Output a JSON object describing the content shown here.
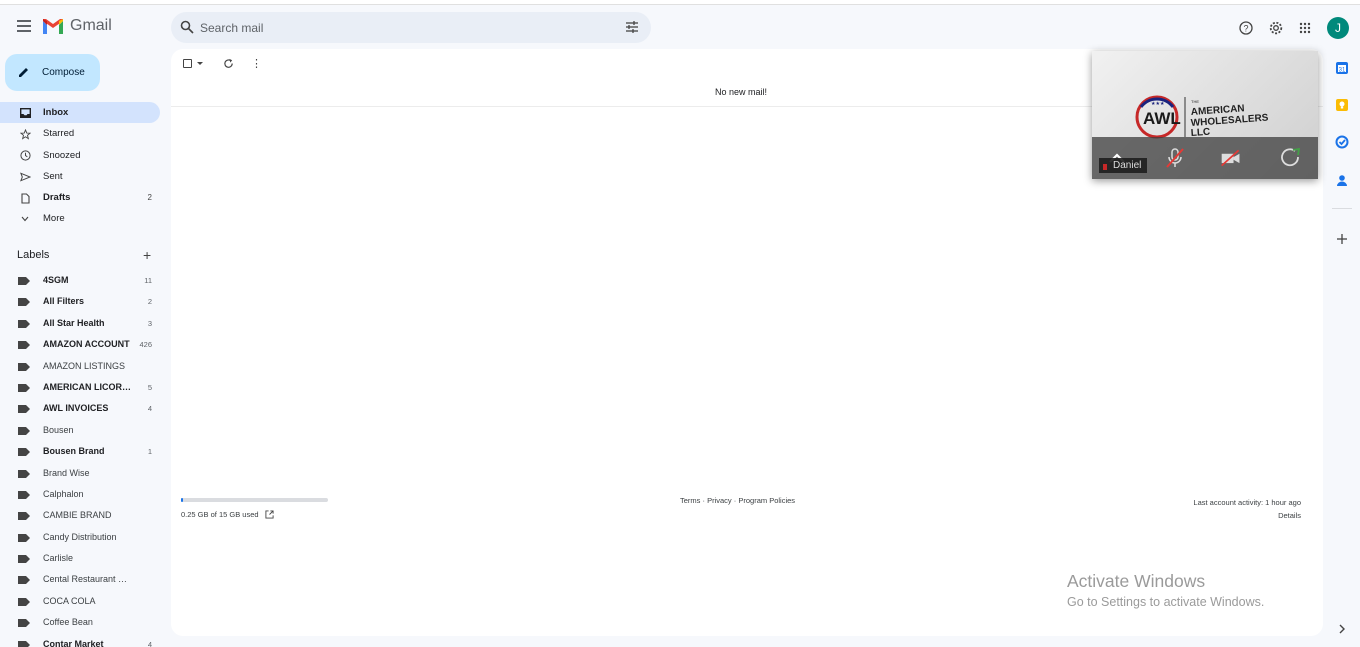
{
  "app": {
    "title": "Gmail"
  },
  "search": {
    "placeholder": "Search mail"
  },
  "header": {
    "avatar_initial": "J",
    "icons": [
      "help-icon",
      "settings-gear-icon",
      "apps-grid-icon"
    ]
  },
  "compose": {
    "label": "Compose"
  },
  "nav": {
    "items": [
      {
        "label": "Inbox",
        "count": "",
        "icon": "inbox-icon",
        "active": true
      },
      {
        "label": "Starred",
        "count": "",
        "icon": "star-icon"
      },
      {
        "label": "Snoozed",
        "count": "",
        "icon": "clock-icon"
      },
      {
        "label": "Sent",
        "count": "",
        "icon": "send-icon"
      },
      {
        "label": "Drafts",
        "count": "2",
        "icon": "draft-icon"
      },
      {
        "label": "More",
        "count": "",
        "icon": "chevron-down-icon"
      }
    ]
  },
  "labels": {
    "header": "Labels",
    "items": [
      {
        "label": "4SGM",
        "count": "11",
        "bold": true
      },
      {
        "label": "All Filters",
        "count": "2",
        "bold": true
      },
      {
        "label": "All Star Health",
        "count": "3",
        "bold": true
      },
      {
        "label": "AMAZON ACCOUNT",
        "count": "426",
        "bold": true
      },
      {
        "label": "AMAZON LISTINGS",
        "count": "",
        "bold": false
      },
      {
        "label": "AMERICAN LICORICE",
        "count": "5",
        "bold": true
      },
      {
        "label": "AWL INVOICES",
        "count": "4",
        "bold": true
      },
      {
        "label": "Bousen",
        "count": "",
        "bold": false
      },
      {
        "label": "Bousen Brand",
        "count": "1",
        "bold": true
      },
      {
        "label": "Brand Wise",
        "count": "",
        "bold": false
      },
      {
        "label": "Calphalon",
        "count": "",
        "bold": false
      },
      {
        "label": "CAMBIE BRAND",
        "count": "",
        "bold": false
      },
      {
        "label": "Candy Distribution",
        "count": "",
        "bold": false
      },
      {
        "label": "Carlisle",
        "count": "",
        "bold": false
      },
      {
        "label": "Cental Restaurant Quotes",
        "count": "",
        "bold": false
      },
      {
        "label": "COCA COLA",
        "count": "",
        "bold": false
      },
      {
        "label": "Coffee Bean",
        "count": "",
        "bold": false
      },
      {
        "label": "Contar Market",
        "count": "4",
        "bold": true
      }
    ]
  },
  "main": {
    "empty_message": "No new mail!",
    "storage_text": "0.25 GB of 15 GB used",
    "storage_fraction": 0.017,
    "footer": {
      "terms": "Terms",
      "privacy": "Privacy",
      "policies": "Program Policies",
      "sep": " · "
    },
    "activity": {
      "text": "Last account activity: 1 hour ago",
      "details": "Details"
    }
  },
  "video": {
    "participant_name": "Daniel",
    "logo_mark": "AWL",
    "logo_the": "THE",
    "logo_line1": "AMERICAN",
    "logo_line2": "WHOLESALERS",
    "logo_line3": "LLC"
  },
  "watermark": {
    "line1": "Activate Windows",
    "line2": "Go to Settings to activate Windows."
  },
  "colors": {
    "accent": "#0b57d0",
    "compose_bg": "#c2e7ff",
    "active_nav": "#d3e3fd",
    "avatar": "#00897b"
  }
}
